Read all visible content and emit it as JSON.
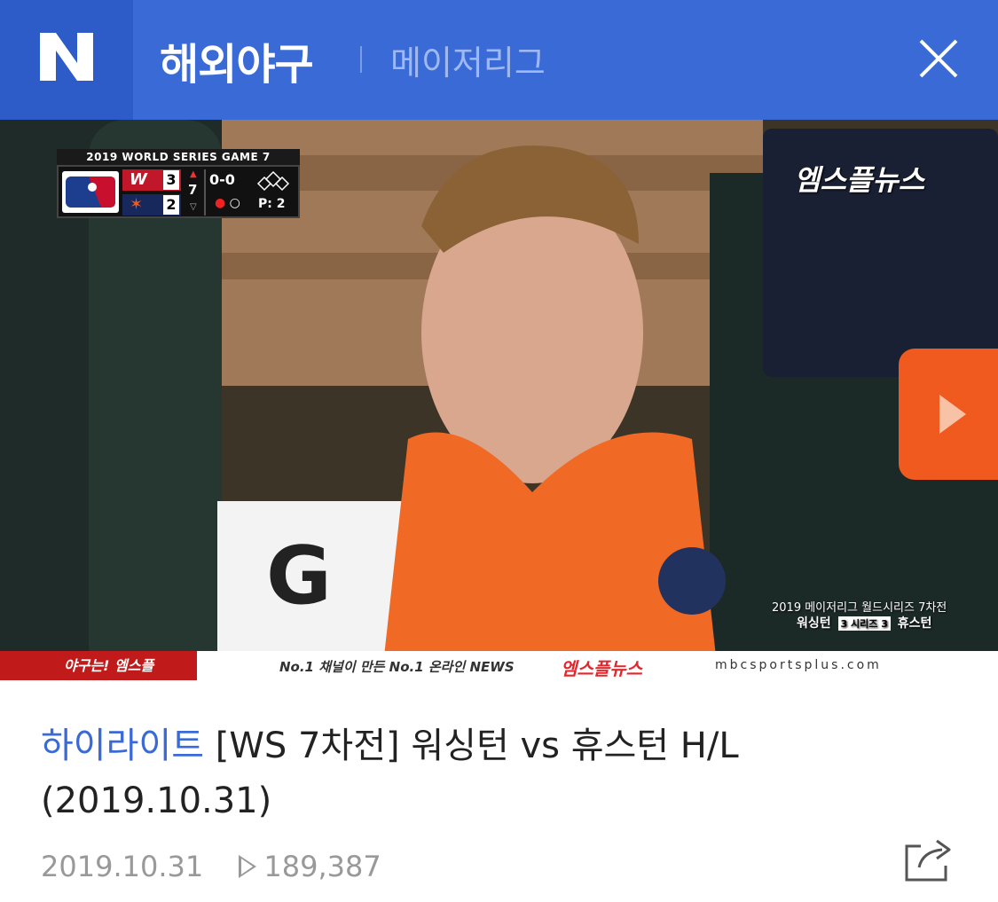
{
  "header": {
    "title": "해외야구",
    "subtitle": "메이저리그",
    "brand_color": "#3a6ad6"
  },
  "video": {
    "scoreboard": {
      "title": "2019 WORLD SERIES GAME 7",
      "away_score": "3",
      "home_score": "2",
      "inning": "7",
      "count": "0-0",
      "pitch_count": "P: 2"
    },
    "channel_logo": "엠스플뉴스",
    "caption_line1": "2019 메이저리그 월드시리즈 7차전",
    "caption_team1": "워싱턴",
    "caption_badge": "3 시리즈 3",
    "caption_team2": "휴스턴",
    "banner_left": "야구는! 엠스플",
    "banner_mid": "No.1 채널이 만든 No.1 온라인 NEWS",
    "banner_logo": "엠스플뉴스",
    "banner_url": "mbcsportsplus.com"
  },
  "article": {
    "category": "하이라이트",
    "title": "[WS 7차전] 워싱턴 vs 휴스턴 H/L (2019.10.31)",
    "date": "2019.10.31",
    "views": "189,387"
  }
}
